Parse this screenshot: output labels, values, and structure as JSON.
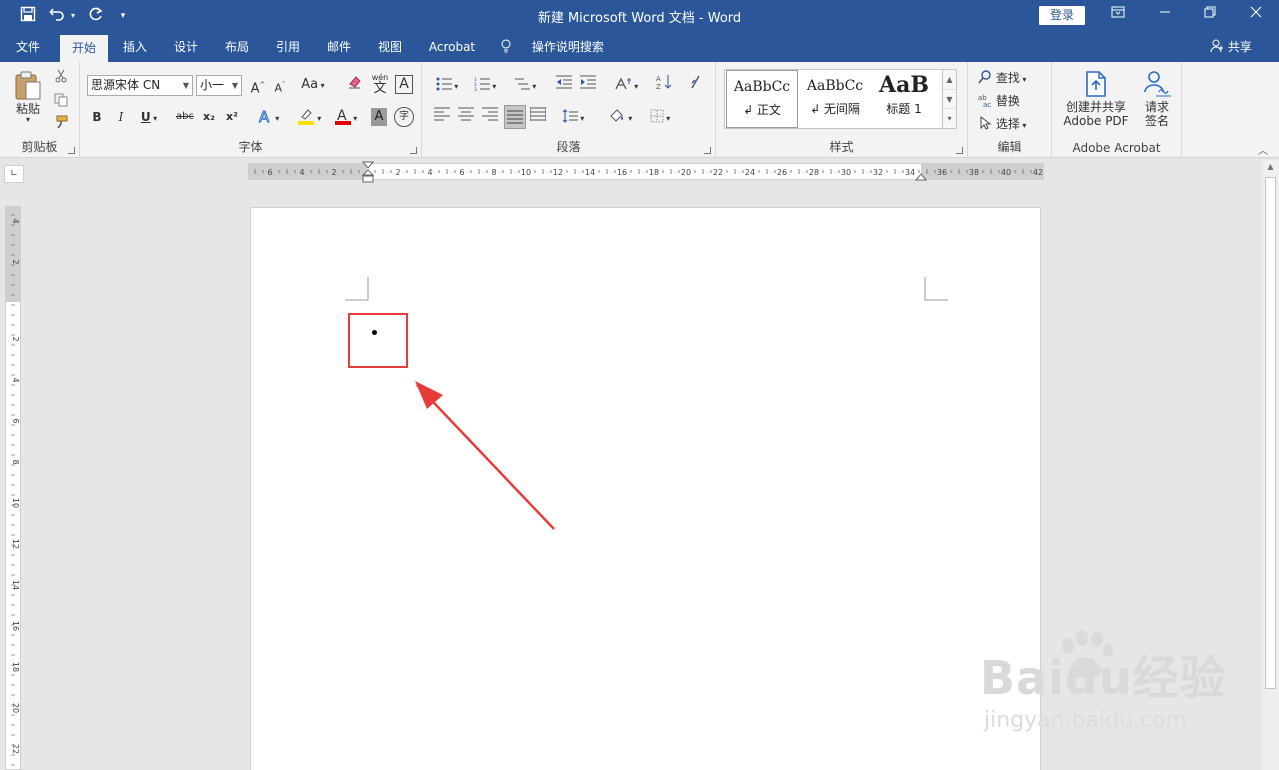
{
  "window": {
    "title": "新建 Microsoft Word 文档  -  Word",
    "login_label": "登录",
    "quick_access": [
      "save-icon",
      "undo-icon",
      "redo-icon",
      "customize-icon"
    ]
  },
  "menu": {
    "tabs": [
      {
        "label": "文件"
      },
      {
        "label": "开始",
        "active": true
      },
      {
        "label": "插入"
      },
      {
        "label": "设计"
      },
      {
        "label": "布局"
      },
      {
        "label": "引用"
      },
      {
        "label": "邮件"
      },
      {
        "label": "视图"
      },
      {
        "label": "Acrobat"
      }
    ],
    "tell_me": "操作说明搜索",
    "share": "共享"
  },
  "ribbon": {
    "clipboard": {
      "label": "剪贴板",
      "paste": "粘贴"
    },
    "font": {
      "label": "字体",
      "font_name": "思源宋体 CN",
      "font_size": "小一",
      "case_button": "Aa",
      "bold": "B",
      "italic": "I",
      "underline": "U",
      "strike": "abc",
      "subscript": "x₂",
      "superscript": "x²",
      "phonetic": "wén",
      "phonetic_char": "文",
      "border_char": "A",
      "shade_char": "A",
      "enclose_char": "字"
    },
    "paragraph": {
      "label": "段落"
    },
    "styles": {
      "label": "样式",
      "items": [
        {
          "preview": "AaBbCc",
          "name": "↲ 正文"
        },
        {
          "preview": "AaBbCc",
          "name": "↲ 无间隔"
        },
        {
          "preview": "AaB",
          "name": "标题 1"
        }
      ]
    },
    "editing": {
      "label": "编辑",
      "find": "查找",
      "replace": "替换",
      "select": "选择"
    },
    "acrobat": {
      "label": "Adobe Acrobat",
      "create_pdf_line1": "创建并共享",
      "create_pdf_line2": "Adobe PDF",
      "sign_line1": "请求",
      "sign_line2": "签名"
    }
  },
  "ruler": {
    "h_ticks": [
      "6",
      "4",
      "2",
      "2",
      "4",
      "6",
      "8",
      "10",
      "12",
      "14",
      "16",
      "18",
      "20",
      "22",
      "24",
      "26",
      "28",
      "30",
      "32",
      "34",
      "36",
      "38",
      "40",
      "42"
    ],
    "v_ticks": [
      "4",
      "2",
      "2",
      "4",
      "6",
      "8",
      "10",
      "12",
      "14",
      "16",
      "18",
      "20",
      "22"
    ]
  },
  "document": {
    "bullet": "•"
  },
  "watermark": {
    "main": "Baidu经验",
    "sub": "jingyan.baidu.com"
  },
  "colors": {
    "title_bar": "#2b579a",
    "highlight": "#e63c3c",
    "font_color_bar": "#e00000",
    "highlight_bar": "#ffe000"
  }
}
